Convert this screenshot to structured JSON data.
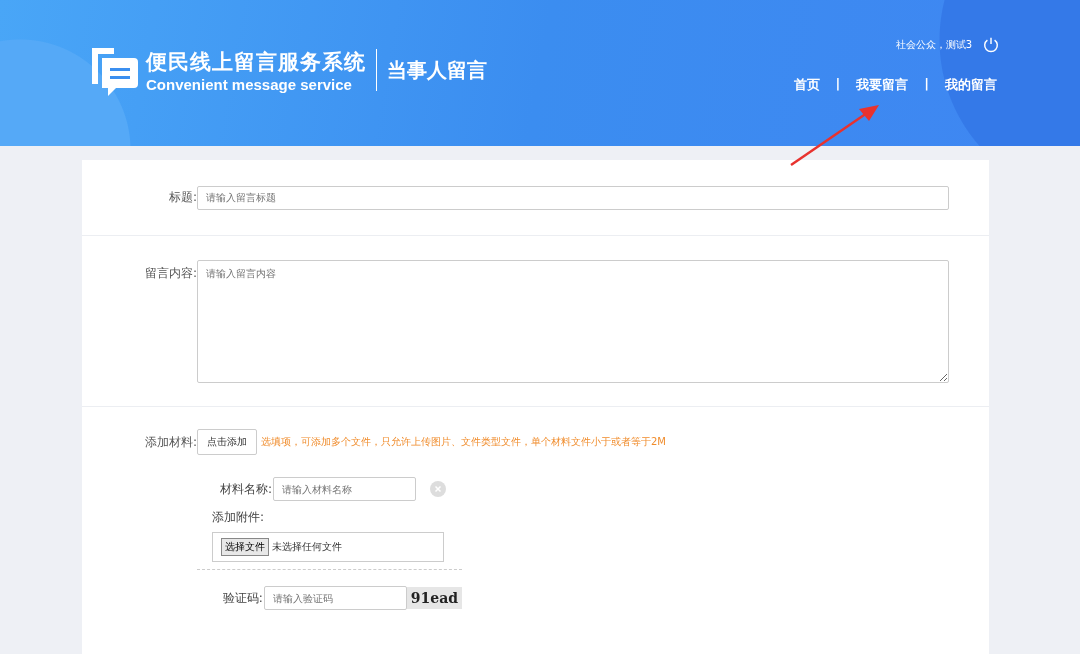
{
  "header": {
    "logo_title": "便民线上留言服务系统",
    "logo_subtitle": "Convenient message service",
    "section_title": "当事人留言",
    "user": "社会公众，测试3",
    "nav": [
      {
        "label": "首页"
      },
      {
        "label": "我要留言"
      },
      {
        "label": "我的留言"
      }
    ],
    "nav_separator": "|"
  },
  "form": {
    "title_label": "标题:",
    "title_placeholder": "请输入留言标题",
    "content_label": "留言内容:",
    "content_placeholder": "请输入留言内容",
    "materials_label": "添加材料:",
    "add_button": "点击添加",
    "materials_hint": "选填项，可添加多个文件，只允许上传图片、文件类型文件，单个材料文件小于或者等于2M",
    "material": {
      "name_label": "材料名称:",
      "name_placeholder": "请输入材料名称",
      "attach_label": "添加附件:",
      "file_button": "选择文件",
      "file_status": "未选择任何文件"
    },
    "captcha_label": "验证码:",
    "captcha_placeholder": "请输入验证码",
    "captcha_image": "91ead"
  }
}
